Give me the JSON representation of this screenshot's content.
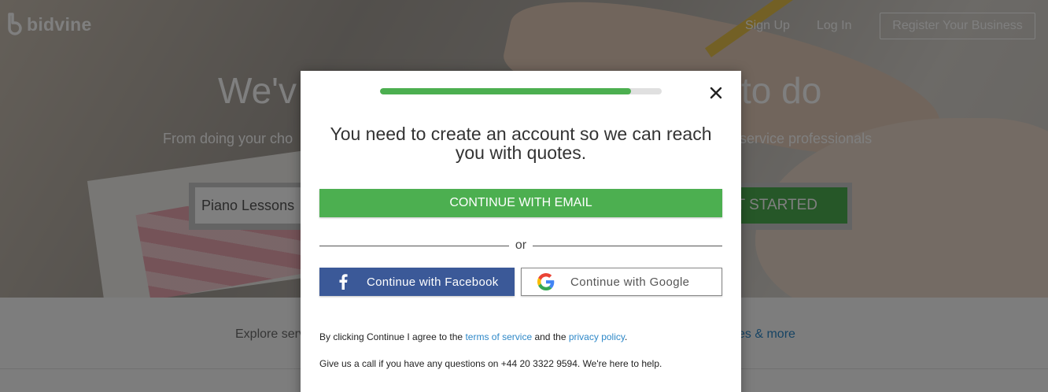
{
  "header": {
    "brand": "bidvine",
    "nav": {
      "signup": "Sign Up",
      "login": "Log In",
      "register": "Register Your Business"
    }
  },
  "hero": {
    "title_start": "We'v",
    "title_end": "to do",
    "subtitle_start": "From doing your cho",
    "subtitle_end": "service professionals",
    "search_value": "Piano Lessons",
    "search_button_partial": "T STARTED"
  },
  "explore": {
    "left": "Explore serv",
    "right": "ces & more"
  },
  "modal": {
    "progress": 0.89,
    "title": "You need to create an account so we can reach you with quotes.",
    "email_button": "CONTINUE WITH EMAIL",
    "or_label": "or",
    "facebook_button": "Continue with Facebook",
    "google_button": "Continue with Google",
    "terms": {
      "prefix": "By clicking Continue I agree to the ",
      "tos_link": "terms of service",
      "middle": " and the ",
      "privacy_link": "privacy policy",
      "suffix": "."
    },
    "phone_line": "Give us a call if you have any questions on +44 20 3322 9594. We're here to help."
  },
  "colors": {
    "accent_green": "#4caf50",
    "facebook_blue": "#3b5998",
    "link_blue": "#2e88c8"
  },
  "icons": {
    "close": "close-icon",
    "facebook": "facebook-icon",
    "google": "google-icon",
    "logo": "bidvine-logo-icon"
  }
}
